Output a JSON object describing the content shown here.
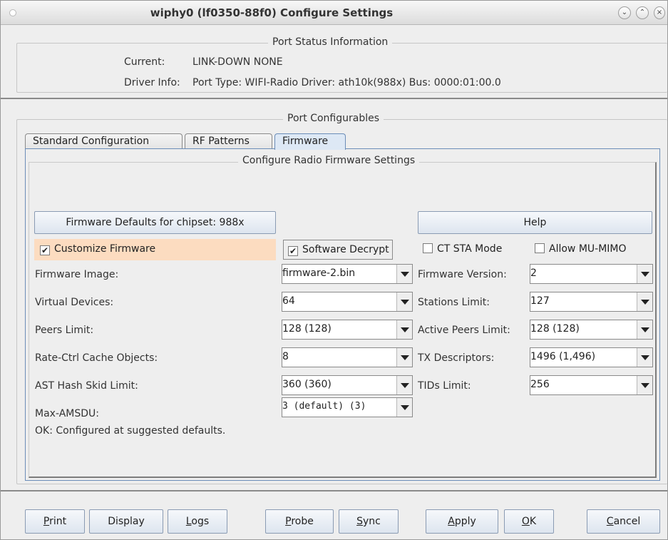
{
  "window": {
    "title": "wiphy0  (lf0350-88f0) Configure Settings"
  },
  "port_status": {
    "section_title": "Port Status Information",
    "current_label": "Current:",
    "current_value": "LINK-DOWN  NONE",
    "driver_info_label": "Driver Info:",
    "driver_info_value": "Port Type: WIFI-Radio   Driver: ath10k(988x)  Bus: 0000:01:00.0"
  },
  "configurables": {
    "section_title": "Port Configurables",
    "tabs": [
      {
        "label": "Standard Configuration",
        "active": false
      },
      {
        "label": "RF Patterns",
        "active": false
      },
      {
        "label": "Firmware",
        "active": true
      }
    ]
  },
  "firmware": {
    "panel_title": "Configure Radio Firmware Settings",
    "defaults_button": "Firmware Defaults for chipset: 988x",
    "help_button": "Help",
    "checkboxes": {
      "customize_firmware": {
        "label": "Customize Firmware",
        "checked": true
      },
      "software_decrypt": {
        "label": "Software Decrypt",
        "checked": true
      },
      "ct_sta_mode": {
        "label": "CT STA Mode",
        "checked": false
      },
      "allow_mu_mimo": {
        "label": "Allow MU-MIMO",
        "checked": false
      }
    },
    "left_fields": [
      {
        "label": "Firmware Image:",
        "value": "firmware-2.bin"
      },
      {
        "label": "Virtual Devices:",
        "value": "64"
      },
      {
        "label": "Peers Limit:",
        "value": "128 (128)"
      },
      {
        "label": "Rate-Ctrl Cache Objects:",
        "value": "8"
      },
      {
        "label": "AST Hash Skid Limit:",
        "value": "360 (360)"
      },
      {
        "label": "Max-AMSDU:",
        "value": "3 (default) (3)"
      }
    ],
    "right_fields": [
      {
        "label": "Firmware Version:",
        "value": "2"
      },
      {
        "label": "Stations Limit:",
        "value": "127"
      },
      {
        "label": "Active Peers Limit:",
        "value": "128 (128)"
      },
      {
        "label": "TX Descriptors:",
        "value": "1496 (1,496)"
      },
      {
        "label": "TIDs Limit:",
        "value": "256"
      }
    ],
    "status_message": "OK: Configured at suggested defaults."
  },
  "bottom_buttons": {
    "print": {
      "mnemonic": "P",
      "rest": "rint"
    },
    "display": "Display",
    "logs": {
      "mnemonic": "L",
      "rest": "ogs"
    },
    "probe": {
      "mnemonic": "P",
      "rest": "robe"
    },
    "sync": {
      "mnemonic": "S",
      "rest": "ync"
    },
    "apply": {
      "mnemonic": "A",
      "rest": "pply"
    },
    "ok": {
      "mnemonic": "O",
      "rest": "K"
    },
    "cancel": {
      "mnemonic": "C",
      "rest": "ancel"
    }
  },
  "colors": {
    "highlight_row": "#fcdcc0",
    "active_tab": "#dde8f5",
    "tab_border": "#6b8db8"
  }
}
